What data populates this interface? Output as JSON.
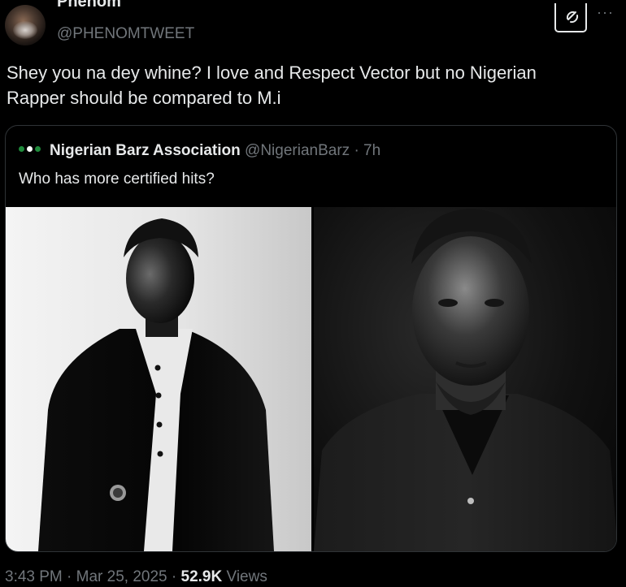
{
  "author": {
    "display_name": "Phenom",
    "handle": "@PHENOMTWEET"
  },
  "tweet": {
    "text_line1": "Shey you na dey whine? I love and Respect Vector but no Nigerian",
    "text_line2": "Rapper should be compared to M.i"
  },
  "quoted_tweet": {
    "display_name": "Nigerian Barz Association",
    "handle": "@NigerianBarz",
    "separator": "·",
    "time": "7h",
    "text": "Who has more certified hits?",
    "flag_colors": [
      "#1f8a3b",
      "#ffffff",
      "#1f8a3b"
    ]
  },
  "meta": {
    "time": "3:43 PM",
    "separator": "·",
    "date": "Mar 25, 2025",
    "views_count": "52.9K",
    "views_label": "Views"
  },
  "icons": {
    "grok": "grok-icon",
    "more": "more-icon"
  }
}
